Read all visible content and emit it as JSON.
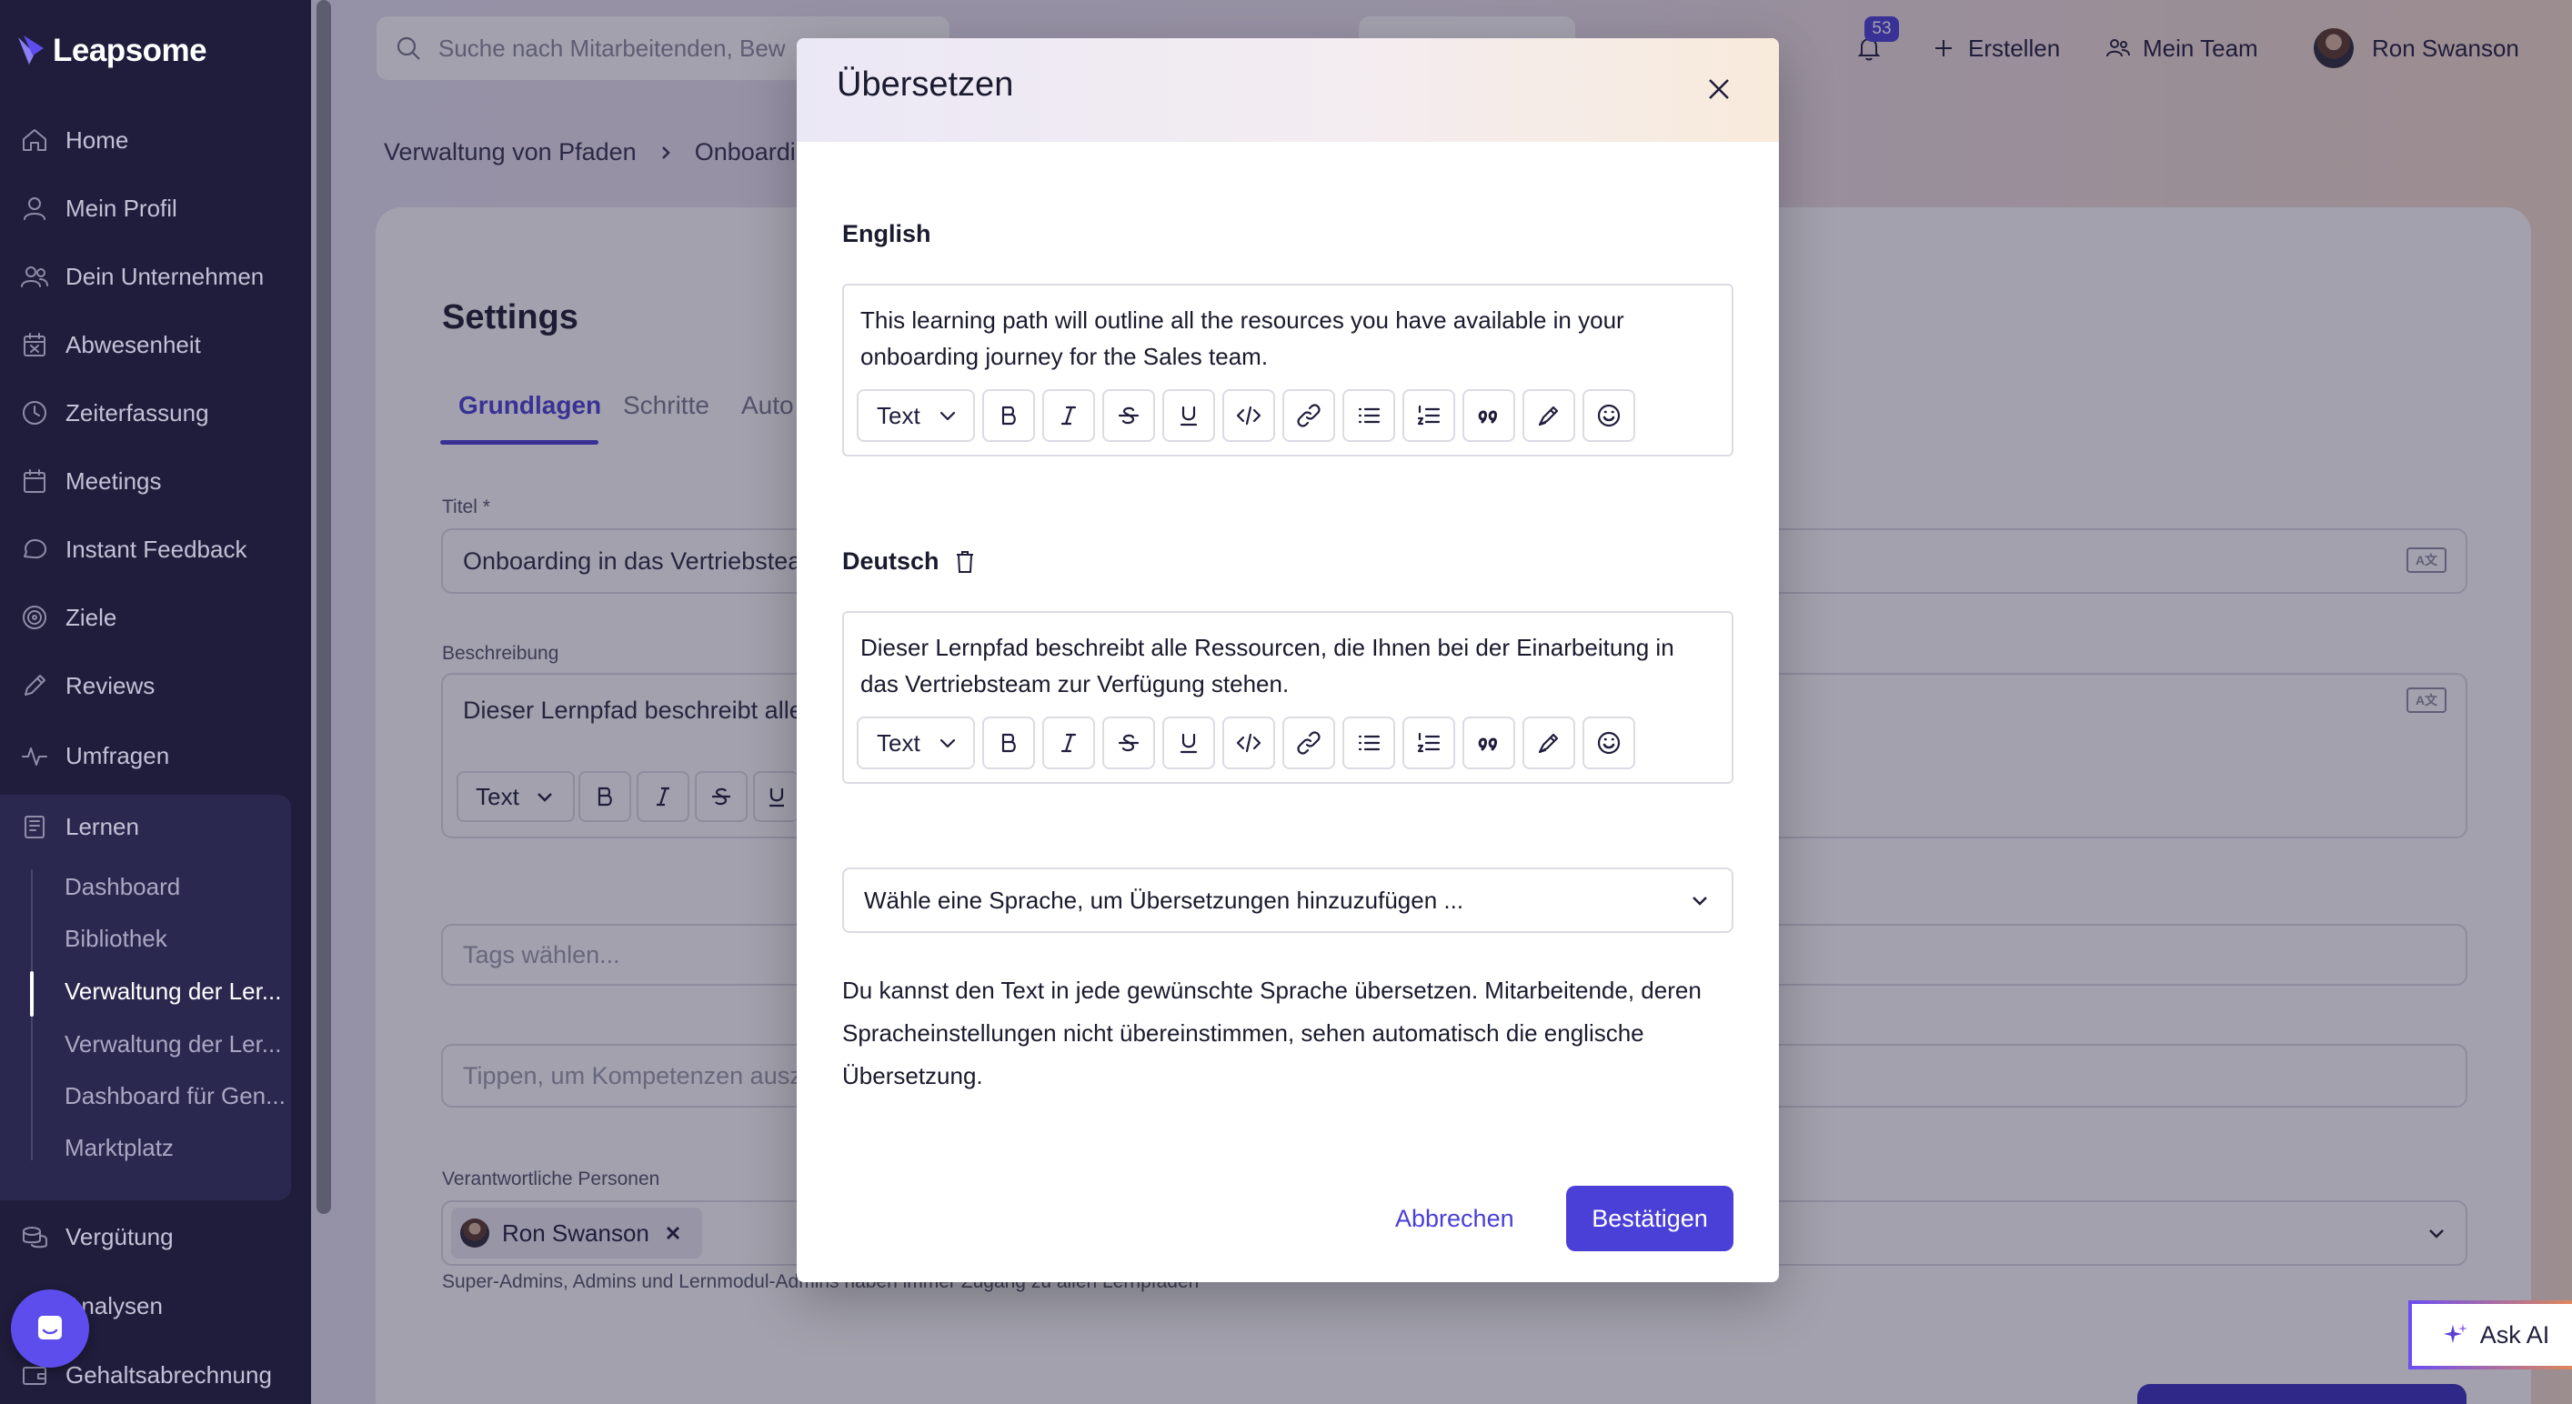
{
  "app": {
    "brand": "Leapsome"
  },
  "sidebar": {
    "items": [
      {
        "label": "Home",
        "icon": "home-icon"
      },
      {
        "label": "Mein Profil",
        "icon": "user-icon"
      },
      {
        "label": "Dein Unternehmen",
        "icon": "users-icon"
      },
      {
        "label": "Abwesenheit",
        "icon": "calendar-x-icon"
      },
      {
        "label": "Zeiterfassung",
        "icon": "clock-icon"
      },
      {
        "label": "Meetings",
        "icon": "calendar-icon"
      },
      {
        "label": "Instant Feedback",
        "icon": "chat-icon"
      },
      {
        "label": "Ziele",
        "icon": "target-icon"
      },
      {
        "label": "Reviews",
        "icon": "pen-icon"
      },
      {
        "label": "Umfragen",
        "icon": "pulse-icon"
      },
      {
        "label": "Lernen",
        "icon": "book-icon"
      },
      {
        "label": "Vergütung",
        "icon": "coins-icon"
      },
      {
        "label": "Analysen",
        "icon": "chart-icon"
      },
      {
        "label": "Gehaltsabrechnung",
        "icon": "wallet-icon"
      }
    ],
    "learn_sub": [
      "Dashboard",
      "Bibliothek",
      "Verwaltung der Ler...",
      "Verwaltung der Ler...",
      "Dashboard für Gen...",
      "Marktplatz"
    ]
  },
  "topbar": {
    "search_placeholder": "Suche nach Mitarbeitenden, Bew",
    "notification_count": "53",
    "create": "Erstellen",
    "my_team": "Mein Team",
    "user_name": "Ron Swanson"
  },
  "breadcrumb": {
    "item1": "Verwaltung von Pfaden",
    "item2": "Onboardin"
  },
  "settings": {
    "title": "Settings",
    "tabs": [
      "Grundlagen",
      "Schritte",
      "Auto"
    ],
    "title_label": "Titel *",
    "title_value": "Onboarding in das Vertriebstea",
    "desc_label": "Beschreibung",
    "desc_value": "Dieser Lernpfad beschreibt alle",
    "text_select": "Text",
    "tags_placeholder": "Tags wählen...",
    "skills_placeholder": "Tippen, um Kompetenzen ausz",
    "owners_label": "Verantwortliche Personen",
    "owner_chip": "Ron Swanson",
    "owners_hint": "Super-Admins, Admins und Lernmodul-Admins haben immer Zugang zu allen Lernpfaden",
    "translate_icon_text": "A文"
  },
  "ask_ai": "Ask AI",
  "modal": {
    "title": "Übersetzen",
    "english_label": "English",
    "english_text": "This learning path will outline all the resources you have available in your onboarding journey for the Sales team.",
    "deutsch_label": "Deutsch",
    "deutsch_text": "Dieser Lernpfad beschreibt alle Ressourcen, die Ihnen bei der Einarbeitung in das Vertriebsteam zur Verfügung stehen.",
    "text_select": "Text",
    "language_select": "Wähle eine Sprache, um Übersetzungen hinzuzufügen ...",
    "info": "Du kannst den Text in jede gewünschte Sprache übersetzen. Mitarbeitende, deren Spracheinstellungen nicht übereinstimmen, sehen automatisch die englische Übersetzung.",
    "cancel": "Abbrechen",
    "confirm": "Bestätigen"
  },
  "colors": {
    "accent": "#4a3fd6",
    "sidebar_bg": "#1f1d3b"
  }
}
